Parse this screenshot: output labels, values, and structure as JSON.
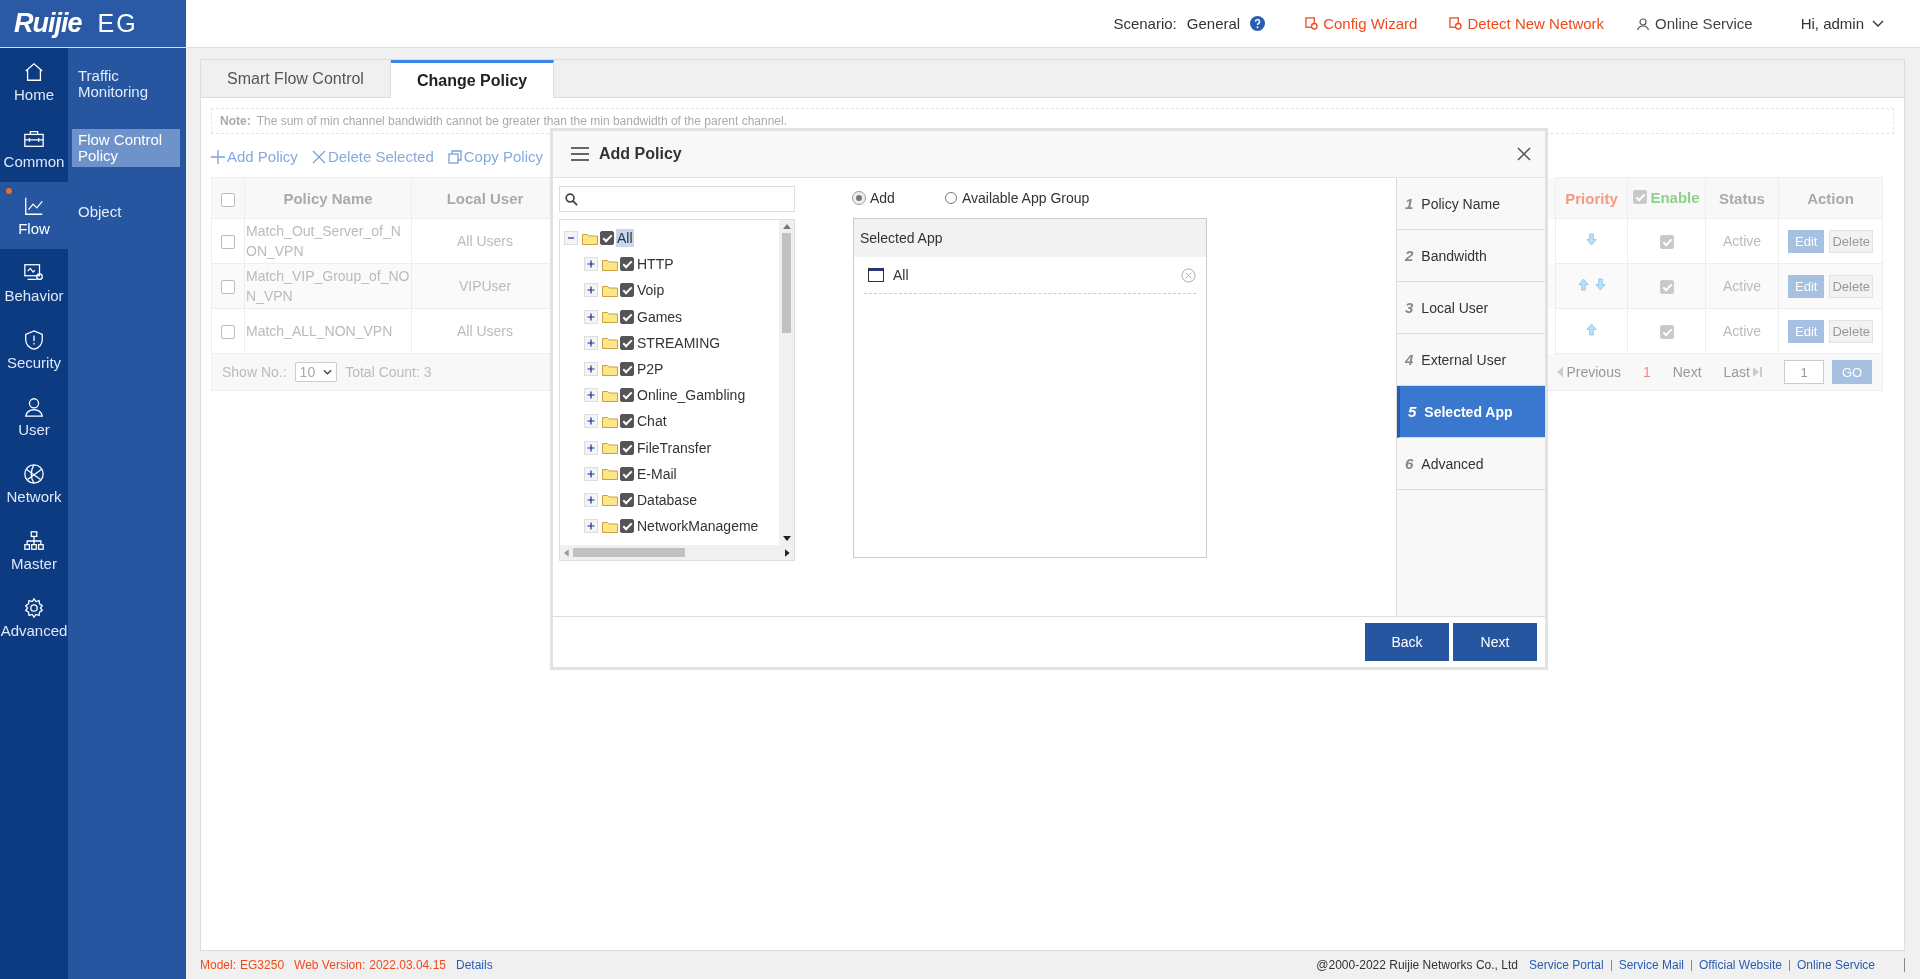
{
  "brand": {
    "logo": "Ruijie",
    "product": "EG"
  },
  "header": {
    "scenario_label": "Scenario:",
    "scenario_value": "General",
    "links": [
      {
        "label": "Config Wizard",
        "kind": "wizard"
      },
      {
        "label": "Detect New Network",
        "kind": "detect"
      },
      {
        "label": "Online Service",
        "kind": "service"
      }
    ],
    "user": "Hi, admin"
  },
  "nav": [
    {
      "label": "Home",
      "selected": false,
      "notice": false
    },
    {
      "label": "Common",
      "selected": false,
      "notice": false
    },
    {
      "label": "Flow",
      "selected": true,
      "notice": true
    },
    {
      "label": "Behavior",
      "selected": false,
      "notice": false
    },
    {
      "label": "Security",
      "selected": false,
      "notice": false
    },
    {
      "label": "User",
      "selected": false,
      "notice": false
    },
    {
      "label": "Network",
      "selected": false,
      "notice": false
    },
    {
      "label": "Master",
      "selected": false,
      "notice": false
    },
    {
      "label": "Advanced",
      "selected": false,
      "notice": false
    }
  ],
  "subnav": [
    {
      "label": "Traffic Monitoring",
      "selected": false
    },
    {
      "label": "Flow Control Policy",
      "selected": true
    },
    {
      "label": "Object",
      "selected": false
    }
  ],
  "tabs": [
    {
      "label": "Smart Flow Control",
      "selected": false
    },
    {
      "label": "Change Policy",
      "selected": true
    }
  ],
  "note": {
    "label": "Note:",
    "text": "The sum of min channel bandwidth cannot be greater than the min bandwidth of the parent channel."
  },
  "toolbar": [
    "Add Policy",
    "Delete Selected",
    "Copy Policy"
  ],
  "table": {
    "columns": {
      "name": "Policy Name",
      "local_user": "Local User",
      "priority": "Priority",
      "enable": "Enable",
      "status": "Status",
      "action": "Action"
    },
    "select_all": false,
    "enable_all": true,
    "rows": [
      {
        "checked": false,
        "name": "Match_Out_Server_of_NON_VPN",
        "local_user": "All Users",
        "up": false,
        "down": true,
        "enabled": true,
        "status": "Active",
        "edit": "Edit",
        "delete": "Delete"
      },
      {
        "checked": false,
        "name": "Match_VIP_Group_of_NON_VPN",
        "local_user": "VIPUser",
        "up": true,
        "down": true,
        "enabled": true,
        "status": "Active",
        "edit": "Edit",
        "delete": "Delete"
      },
      {
        "checked": false,
        "name": "Match_ALL_NON_VPN",
        "local_user": "All Users",
        "up": true,
        "down": false,
        "enabled": true,
        "status": "Active",
        "edit": "Edit",
        "delete": "Delete"
      }
    ]
  },
  "pager": {
    "show_label": "Show No.:",
    "page_size": "10",
    "total": "Total Count: 3",
    "previous": "Previous",
    "page": "1",
    "next": "Next",
    "last": "Last",
    "goto": "1",
    "go": "GO"
  },
  "dialog": {
    "title": "Add Policy",
    "tree": {
      "label": "All",
      "expanded": true,
      "checked": true,
      "selected": true,
      "children": [
        {
          "label": "HTTP",
          "expanded": false,
          "checked": true,
          "selected": false
        },
        {
          "label": "Voip",
          "expanded": false,
          "checked": true,
          "selected": false
        },
        {
          "label": "Games",
          "expanded": false,
          "checked": true,
          "selected": false
        },
        {
          "label": "STREAMING",
          "expanded": false,
          "checked": true,
          "selected": false
        },
        {
          "label": "P2P",
          "expanded": false,
          "checked": true,
          "selected": false
        },
        {
          "label": "Online_Gambling",
          "expanded": false,
          "checked": true,
          "selected": false
        },
        {
          "label": "Chat",
          "expanded": false,
          "checked": true,
          "selected": false
        },
        {
          "label": "FileTransfer",
          "expanded": false,
          "checked": true,
          "selected": false
        },
        {
          "label": "E-Mail",
          "expanded": false,
          "checked": true,
          "selected": false
        },
        {
          "label": "Database",
          "expanded": false,
          "checked": true,
          "selected": false
        },
        {
          "label": "NetworkManageme",
          "expanded": false,
          "checked": true,
          "selected": false
        }
      ]
    },
    "modes": [
      {
        "label": "Add",
        "selected": true
      },
      {
        "label": "Available App Group",
        "selected": false
      }
    ],
    "selected_app": {
      "title": "Selected App",
      "items": [
        "All"
      ]
    },
    "steps": [
      {
        "number": "1",
        "label": "Policy Name",
        "selected": false
      },
      {
        "number": "2",
        "label": "Bandwidth",
        "selected": false
      },
      {
        "number": "3",
        "label": "Local User",
        "selected": false
      },
      {
        "number": "4",
        "label": "External User",
        "selected": false
      },
      {
        "number": "5",
        "label": "Selected App",
        "selected": true
      },
      {
        "number": "6",
        "label": "Advanced",
        "selected": false
      }
    ],
    "buttons": [
      "Back",
      "Next"
    ]
  },
  "footer": {
    "model_label": "Model:",
    "model": "EG3250",
    "version_label": "Web Version:",
    "version": "2022.03.04.15",
    "details": "Details",
    "copyright": "@2000-2022 Ruijie Networks Co., Ltd",
    "links": [
      "Service Portal",
      "Service Mail",
      "Official Website",
      "Online Service"
    ]
  }
}
